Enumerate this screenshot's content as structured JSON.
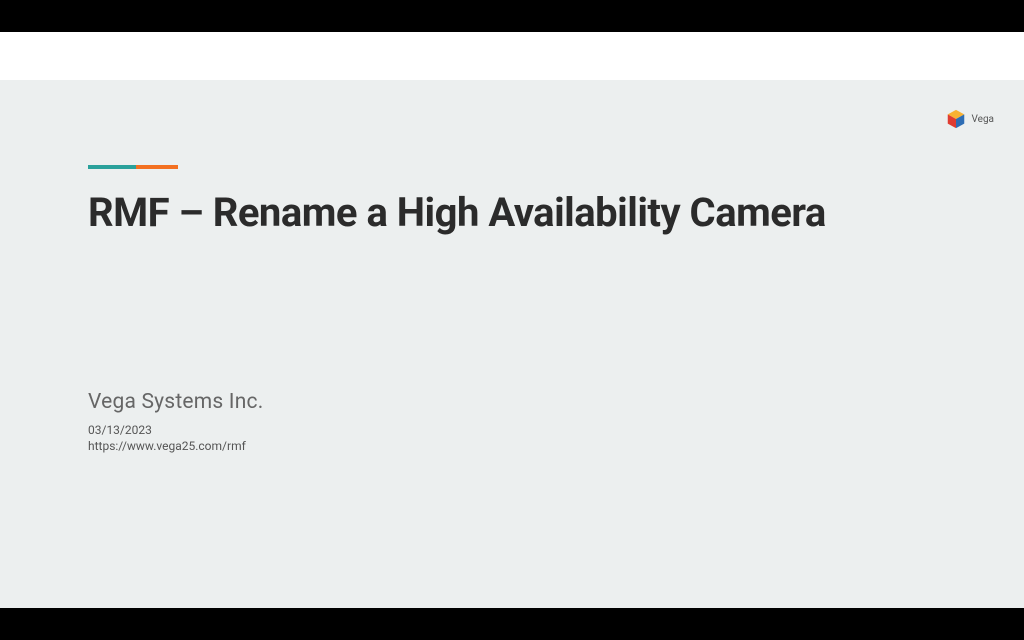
{
  "slide": {
    "title": "RMF – Rename a High Availability Camera",
    "company": "Vega Systems Inc.",
    "date": "03/13/2023",
    "url": "https://www.vega25.com/rmf"
  },
  "logo": {
    "text": "Vega"
  }
}
